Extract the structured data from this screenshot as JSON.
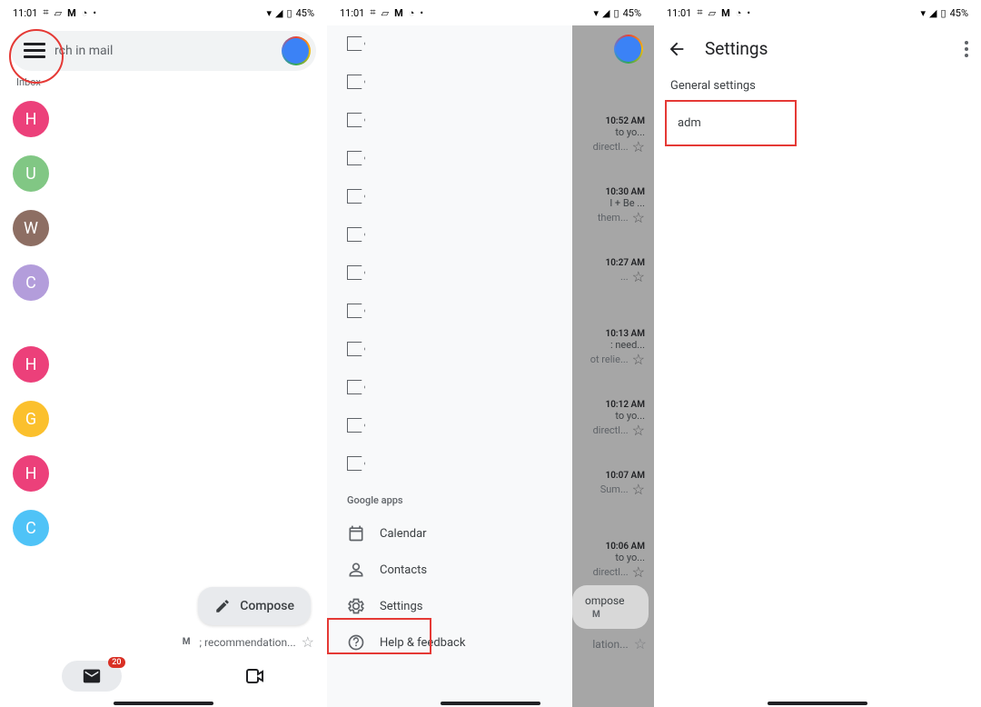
{
  "statusbar": {
    "time": "11:01",
    "battery": "45%"
  },
  "screen1": {
    "search_placeholder": "rch in mail",
    "inbox_label": "Inbox",
    "avatars": [
      {
        "letter": "H",
        "cls": "pink"
      },
      {
        "letter": "U",
        "cls": "green"
      },
      {
        "letter": "W",
        "cls": "gray"
      },
      {
        "letter": "C",
        "cls": "lav"
      },
      {
        "letter": "H",
        "cls": "pink"
      },
      {
        "letter": "G",
        "cls": "yellow"
      },
      {
        "letter": "H",
        "cls": "pink"
      },
      {
        "letter": "C",
        "cls": "blue"
      }
    ],
    "compose": "Compose",
    "rec_text": "; recommendation...",
    "mail_badge": "20"
  },
  "screen2": {
    "section_title": "Google apps",
    "calendar": "Calendar",
    "contacts": "Contacts",
    "settings": "Settings",
    "help": "Help & feedback",
    "rows": [
      {
        "time": "10:52 AM",
        "line1": "to yo...",
        "line2": "directl..."
      },
      {
        "time": "10:30 AM",
        "line1": "l + Be ...",
        "line2": "them..."
      },
      {
        "time": "10:27 AM",
        "line1": "",
        "line2": "..."
      },
      {
        "time": "10:13 AM",
        "line1": ": need...",
        "line2": "ot relie..."
      },
      {
        "time": "10:12 AM",
        "line1": "to yo...",
        "line2": "directl..."
      },
      {
        "time": "10:07 AM",
        "line1": "",
        "line2": "Sum..."
      },
      {
        "time": "10:06 AM",
        "line1": "to yo...",
        "line2": "directl..."
      }
    ],
    "compose_ghost": "ompose",
    "rec_text": "lation..."
  },
  "screen3": {
    "title": "Settings",
    "general": "General settings",
    "account": "adm"
  }
}
